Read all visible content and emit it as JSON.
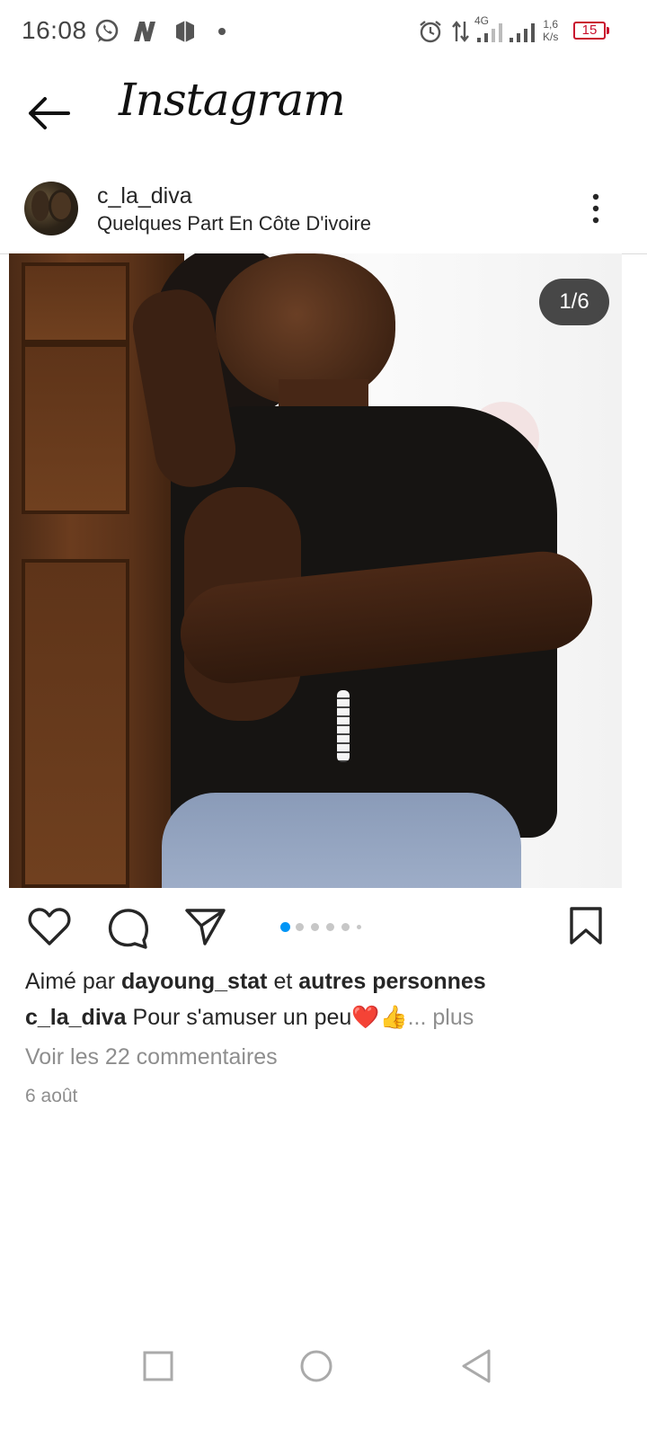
{
  "status_bar": {
    "time": "16:08",
    "network": "4G",
    "speed_value": "1,6",
    "speed_unit": "K/s",
    "battery": "15",
    "icons": [
      "whatsapp-icon",
      "n-app-icon",
      "shield-app-icon",
      "alarm-icon",
      "data-arrows-icon",
      "signal-icon",
      "signal-icon"
    ]
  },
  "app_bar": {
    "title": "Instagram"
  },
  "post": {
    "username": "c_la_diva",
    "location": "Quelques Part En Côte D'ivoire",
    "image_counter": "1/6",
    "carousel": {
      "total": 6,
      "active_index": 0
    },
    "likes": {
      "prefix": "Aimé par ",
      "user": "dayoung_stat",
      "middle": " et ",
      "others": "autres personnes"
    },
    "caption": {
      "user": "c_la_diva",
      "text": " Pour s'amuser un peu❤️👍",
      "more": "... plus"
    },
    "comments_link": "Voir les 22 commentaires",
    "date": "6 août"
  },
  "colors": {
    "accent_blue": "#0095f6",
    "battery_red": "#c8102e",
    "secondary_text": "#8e8e8e"
  }
}
